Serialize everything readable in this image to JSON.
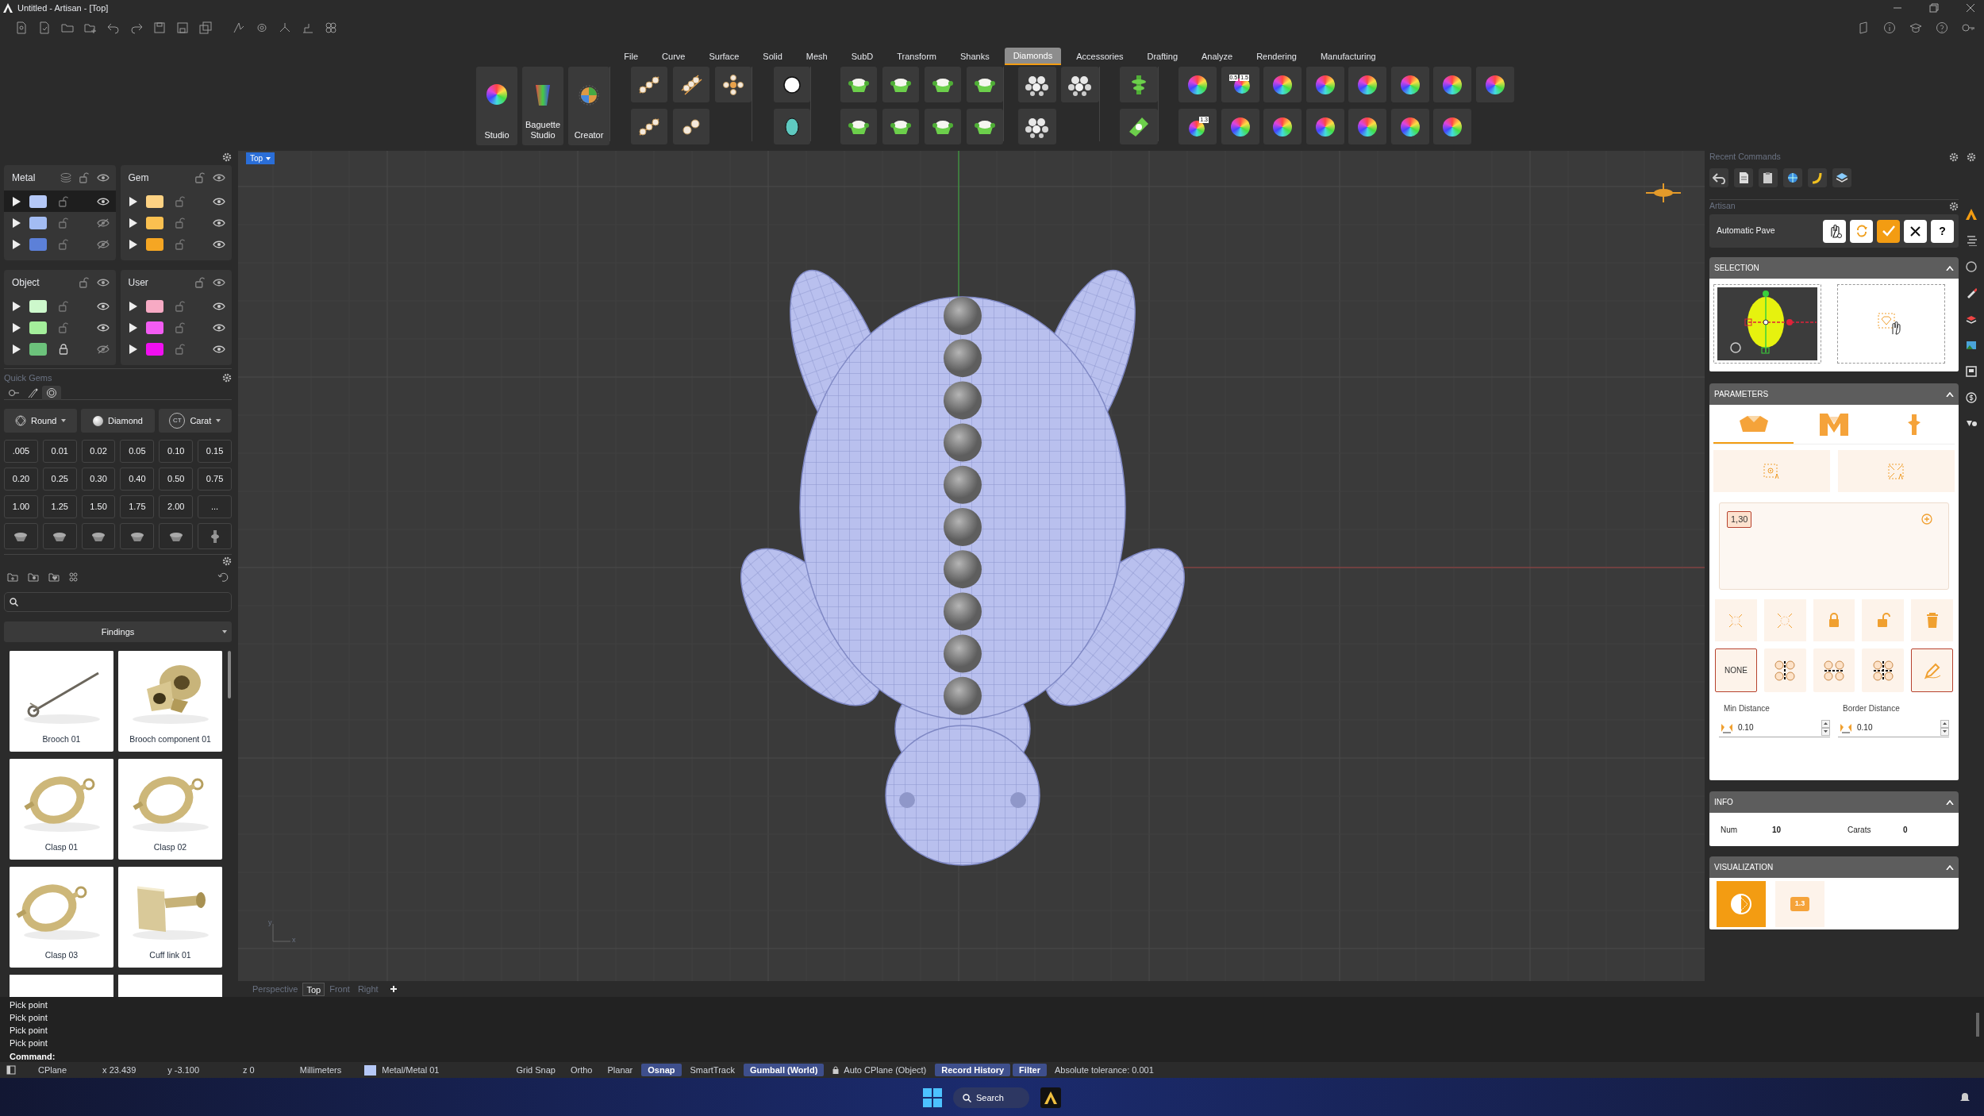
{
  "window": {
    "title": "Untitled - Artisan - [Top]"
  },
  "menu_tabs": [
    {
      "label": "File",
      "selected": false
    },
    {
      "label": "Curve",
      "selected": false
    },
    {
      "label": "Surface",
      "selected": false
    },
    {
      "label": "Solid",
      "selected": false
    },
    {
      "label": "Mesh",
      "selected": false
    },
    {
      "label": "SubD",
      "selected": false
    },
    {
      "label": "Transform",
      "selected": false
    },
    {
      "label": "Shanks",
      "selected": false
    },
    {
      "label": "Diamonds",
      "selected": true
    },
    {
      "label": "Accessories",
      "selected": false
    },
    {
      "label": "Drafting",
      "selected": false
    },
    {
      "label": "Analyze",
      "selected": false
    },
    {
      "label": "Rendering",
      "selected": false
    },
    {
      "label": "Manufacturing",
      "selected": false
    }
  ],
  "ribbon": {
    "big_buttons": [
      {
        "label": "Studio"
      },
      {
        "label": "Baguette Studio"
      },
      {
        "label": "Creator"
      }
    ],
    "ruler_icon_labels": [
      "0.5",
      "1.5"
    ],
    "size_icon_label": "1.3"
  },
  "layer_groups": [
    {
      "name": "Metal",
      "kind": "metal",
      "rows": [
        {
          "color": "#b5c8f7",
          "locked": false,
          "visible": true,
          "selected": true
        },
        {
          "color": "#a3bcf3",
          "locked": false,
          "visible": false,
          "selected": false
        },
        {
          "color": "#5c80d8",
          "locked": false,
          "visible": false,
          "selected": false
        }
      ]
    },
    {
      "name": "Gem",
      "kind": "gem",
      "rows": [
        {
          "color": "#fdd283",
          "locked": false,
          "visible": true,
          "selected": false
        },
        {
          "color": "#fac050",
          "locked": false,
          "visible": true,
          "selected": false
        },
        {
          "color": "#f5a623",
          "locked": false,
          "visible": true,
          "selected": false
        }
      ]
    },
    {
      "name": "Object",
      "kind": "object",
      "rows": [
        {
          "color": "#cdf8cc",
          "locked": false,
          "visible": true,
          "selected": false
        },
        {
          "color": "#a4ef9b",
          "locked": false,
          "visible": true,
          "selected": false
        },
        {
          "color": "#6cc27b",
          "locked": true,
          "visible": false,
          "selected": false
        }
      ]
    },
    {
      "name": "User",
      "kind": "user",
      "rows": [
        {
          "color": "#f7aac4",
          "locked": false,
          "visible": true,
          "selected": false
        },
        {
          "color": "#f35cf3",
          "locked": false,
          "visible": true,
          "selected": false
        },
        {
          "color": "#f00ff0",
          "locked": false,
          "visible": true,
          "selected": false
        }
      ]
    }
  ],
  "quick_gems": {
    "title": "Quick Gems",
    "tabs": [
      {
        "selected": false
      },
      {
        "selected": false
      },
      {
        "selected": true
      }
    ],
    "selectors": [
      {
        "kind": "cut",
        "label": "Round"
      },
      {
        "kind": "material",
        "label": "Diamond"
      },
      {
        "kind": "unit",
        "label": "Carat",
        "icon_text": "CT"
      }
    ],
    "sizes": [
      ".005",
      "0.01",
      "0.02",
      "0.05",
      "0.10",
      "0.15",
      "0.20",
      "0.25",
      "0.30",
      "0.40",
      "0.50",
      "0.75",
      "1.00",
      "1.25",
      "1.50",
      "1.75",
      "2.00",
      "..."
    ]
  },
  "library": {
    "category": "Findings",
    "items": [
      {
        "label": "Brooch 01"
      },
      {
        "label": "Brooch component 01"
      },
      {
        "label": "Clasp 01"
      },
      {
        "label": "Clasp 02"
      },
      {
        "label": "Clasp 03"
      },
      {
        "label": "Cuff link 01"
      }
    ]
  },
  "viewport": {
    "label": "Top",
    "axis_labels": [
      "y",
      "x"
    ],
    "tabs": [
      {
        "label": "Perspective",
        "selected": false
      },
      {
        "label": "Top",
        "selected": true
      },
      {
        "label": "Front",
        "selected": false
      },
      {
        "label": "Right",
        "selected": false
      }
    ]
  },
  "recent_commands": {
    "title": "Recent Commands"
  },
  "artisan": {
    "title": "Artisan",
    "command": "Automatic Pave",
    "help_label": "?",
    "selection": {
      "title": "SELECTION"
    },
    "parameters": {
      "title": "PARAMETERS",
      "tabs": [
        {
          "selected": true
        },
        {
          "selected": false
        },
        {
          "selected": false
        }
      ],
      "size_chip": "1,30",
      "patterns": [
        {
          "kind": "none",
          "label": "NONE",
          "selected": true
        },
        {
          "kind": "vertical",
          "selected": false
        },
        {
          "kind": "horizontal",
          "selected": false
        },
        {
          "kind": "cross",
          "selected": false
        }
      ],
      "manual_edit_on": true,
      "min_distance": {
        "label": "Min Distance",
        "value": "0.10"
      },
      "border_distance": {
        "label": "Border Distance",
        "value": "0.10"
      }
    },
    "info": {
      "title": "INFO",
      "num_label": "Num",
      "num": "10",
      "carats_label": "Carats",
      "carats": "0"
    },
    "visualization": {
      "title": "VISUALIZATION",
      "options": [
        {
          "kind": "shade",
          "selected": true
        },
        {
          "kind": "size",
          "label": "1.3",
          "selected": false
        }
      ]
    }
  },
  "command_history": [
    "Pick point",
    "Pick point",
    "Pick point",
    "Pick point"
  ],
  "command_prompt": "Command:",
  "status_bar": {
    "cplane": "CPlane",
    "x": "x 23.439",
    "y": "y -3.100",
    "z": "z 0",
    "units": "Millimeters",
    "layer": {
      "name": "Metal/Metal 01",
      "color": "#b5c8f7"
    },
    "toggles": [
      {
        "kind": "plain",
        "label": "Grid Snap",
        "on": false
      },
      {
        "kind": "plain",
        "label": "Ortho",
        "on": false
      },
      {
        "kind": "plain",
        "label": "Planar",
        "on": false
      },
      {
        "kind": "plain",
        "label": "Osnap",
        "on": true
      },
      {
        "kind": "plain",
        "label": "SmartTrack",
        "on": false
      },
      {
        "kind": "plain",
        "label": "Gumball (World)",
        "on": true
      },
      {
        "kind": "lockable",
        "label": "Auto CPlane (Object)",
        "on": false
      },
      {
        "kind": "plain",
        "label": "Record History",
        "on": true
      },
      {
        "kind": "plain",
        "label": "Filter",
        "on": true
      }
    ],
    "tolerance": "Absolute tolerance: 0.001"
  },
  "taskbar": {
    "search": "Search"
  }
}
